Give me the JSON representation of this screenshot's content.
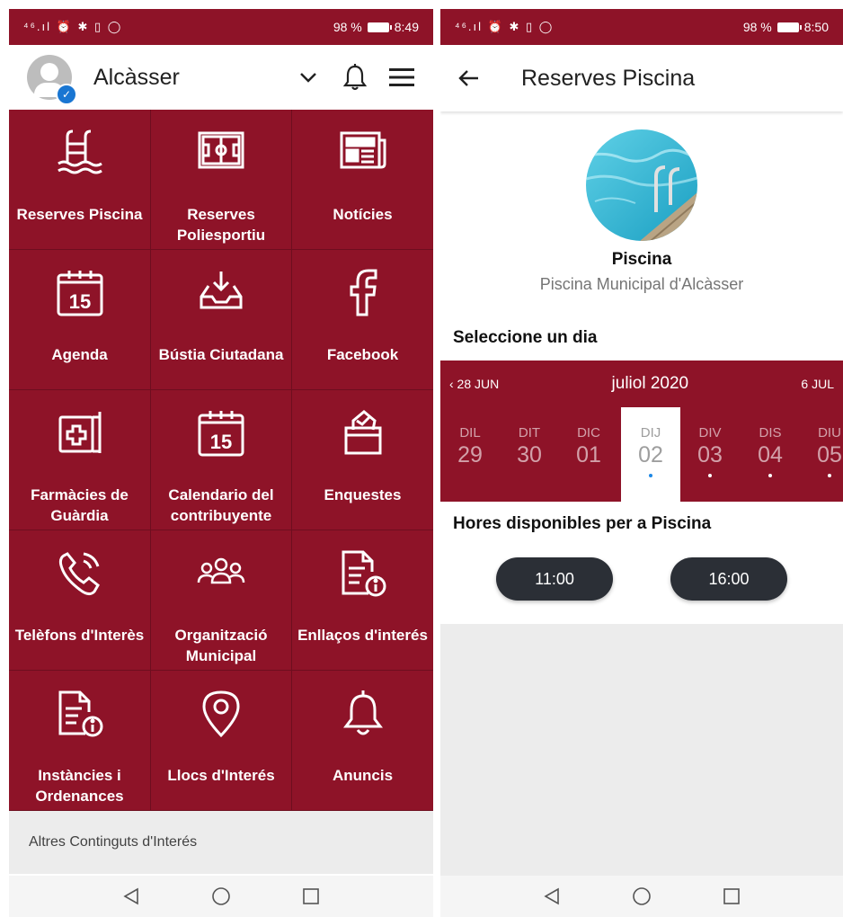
{
  "left": {
    "status": {
      "icons": "⁴⁶.ıl ⏰ ✱ ▯ ◯",
      "battery": "98 %",
      "time": "8:49"
    },
    "header": {
      "title": "Alcàsser"
    },
    "tiles": [
      {
        "label": "Reserves Piscina",
        "icon": "pool-ladder-icon"
      },
      {
        "label": "Reserves Poliesportiu",
        "icon": "sports-field-icon"
      },
      {
        "label": "Notícies",
        "icon": "newspaper-icon"
      },
      {
        "label": "Agenda",
        "icon": "calendar-15-icon"
      },
      {
        "label": "Bústia Ciutadana",
        "icon": "inbox-tray-icon"
      },
      {
        "label": "Facebook",
        "icon": "facebook-icon"
      },
      {
        "label": "Farmàcies de Guàrdia",
        "icon": "first-aid-icon"
      },
      {
        "label": "Calendario del contribuyente",
        "icon": "calendar-15-icon"
      },
      {
        "label": "Enquestes",
        "icon": "ballot-box-icon"
      },
      {
        "label": "Telèfons d'Interès",
        "icon": "phone-icon"
      },
      {
        "label": "Organització Municipal",
        "icon": "group-icon"
      },
      {
        "label": "Enllaços d'interés",
        "icon": "document-info-icon"
      },
      {
        "label": "Instàncies i Ordenances",
        "icon": "document-info-icon"
      },
      {
        "label": "Llocs d'Interés",
        "icon": "location-pin-icon"
      },
      {
        "label": "Anuncis",
        "icon": "bell-icon"
      }
    ],
    "other_content": "Altres Continguts d'Interés"
  },
  "right": {
    "status": {
      "icons": "⁴⁶.ıl ⏰ ✱ ▯ ◯",
      "battery": "98 %",
      "time": "8:50"
    },
    "header": {
      "title": "Reserves Piscina"
    },
    "venue": {
      "name": "Piscina",
      "subtitle": "Piscina Municipal d'Alcàsser"
    },
    "select_day_label": "Seleccione un dia",
    "calendar": {
      "prev": "‹ 28 JUN",
      "month": "juliol 2020",
      "next": "6 JUL",
      "days": [
        {
          "name": "DIL",
          "num": "29",
          "dot": false,
          "selected": false
        },
        {
          "name": "DIT",
          "num": "30",
          "dot": false,
          "selected": false
        },
        {
          "name": "DIC",
          "num": "01",
          "dot": false,
          "selected": false
        },
        {
          "name": "DIJ",
          "num": "02",
          "dot": true,
          "selected": true
        },
        {
          "name": "DIV",
          "num": "03",
          "dot": true,
          "selected": false
        },
        {
          "name": "DIS",
          "num": "04",
          "dot": true,
          "selected": false
        },
        {
          "name": "DIU",
          "num": "05",
          "dot": true,
          "selected": false
        }
      ]
    },
    "hours_label": "Hores disponibles per a Piscina",
    "slots": [
      "11:00",
      "16:00"
    ]
  },
  "colors": {
    "brand": "#8e1328",
    "slot": "#2b2f36",
    "selected_dot": "#1e88e5"
  }
}
